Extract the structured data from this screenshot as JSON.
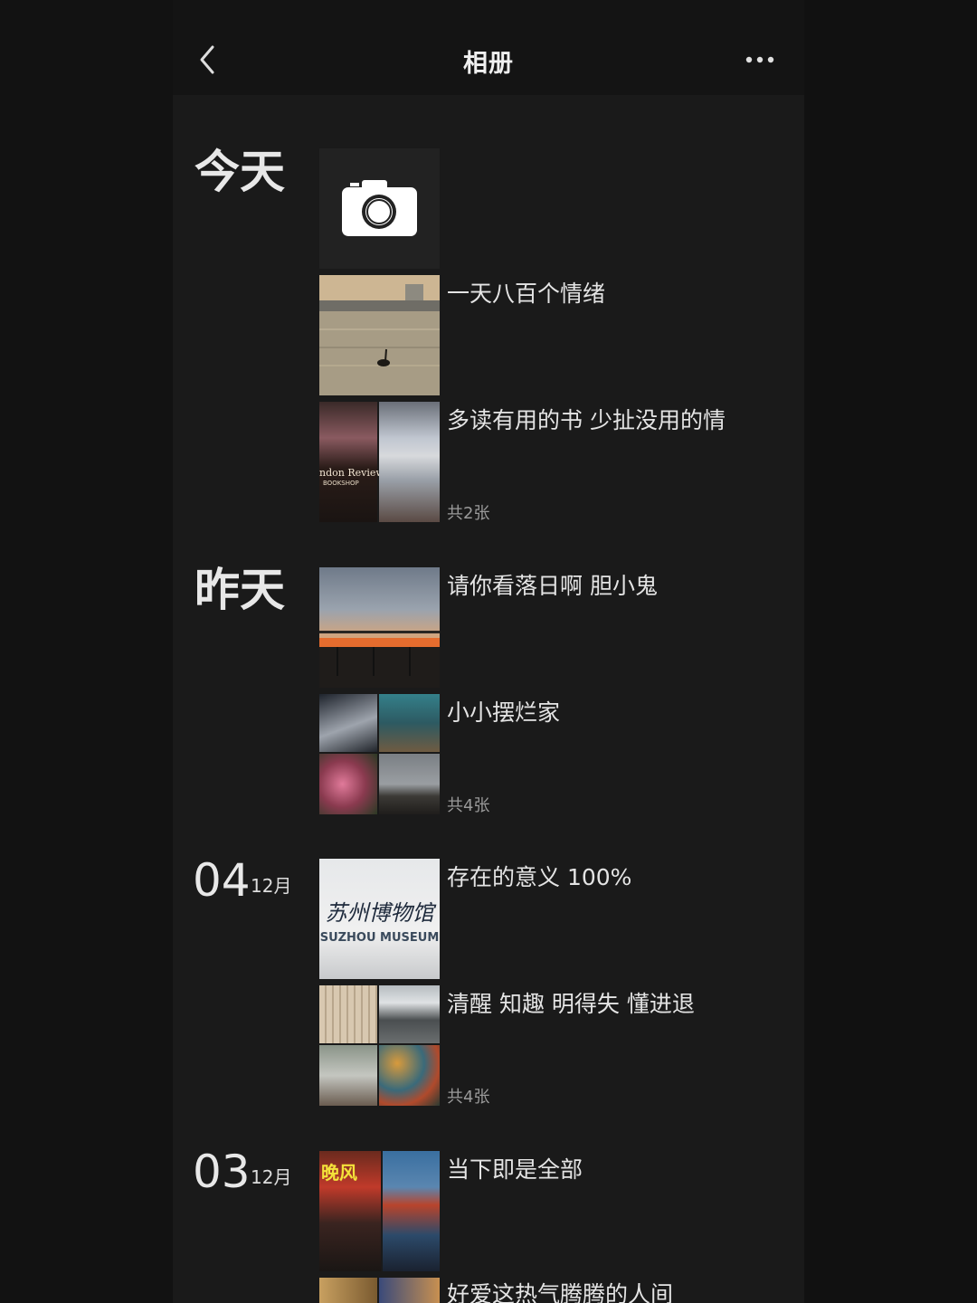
{
  "header": {
    "title": "相册",
    "back_icon": "chevron-left-icon",
    "more_icon": "more-horizontal-icon"
  },
  "groups": [
    {
      "date_label": "今天",
      "camera_icon": "camera-icon",
      "posts": [
        {
          "caption": "一天八百个情绪"
        },
        {
          "caption": "多读有用的书 少扯没用的情",
          "count": "共2张"
        }
      ]
    },
    {
      "date_label": "昨天",
      "posts": [
        {
          "caption": "请你看落日啊 胆小鬼"
        },
        {
          "caption": "小小摆烂家",
          "count": "共4张"
        }
      ]
    },
    {
      "day": "04",
      "month": "12月",
      "posts": [
        {
          "caption": "存在的意义 100%",
          "photo_text": "苏州博物馆",
          "photo_text_en": "SUZHOU MUSEUM"
        },
        {
          "caption": "清醒 知趣 明得失 懂进退",
          "count": "共4张"
        }
      ]
    },
    {
      "day": "03",
      "month": "12月",
      "posts": [
        {
          "caption": "当下即是全部",
          "photo_text": "晚风"
        },
        {
          "caption": "好爱这热气腾腾的人间"
        }
      ]
    }
  ],
  "photo_signs": {
    "bookshop": "ndon Review",
    "bookshop_sub": "BOOKSHOP"
  }
}
